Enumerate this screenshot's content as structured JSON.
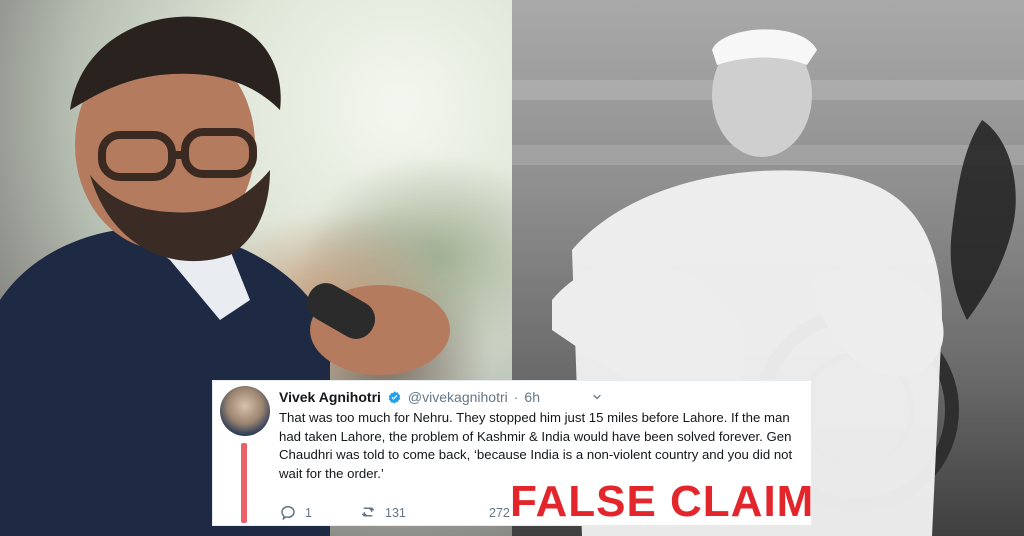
{
  "tweet": {
    "display_name": "Vivek Agnihotri",
    "handle": "@vivekagnihotri",
    "dot": "·",
    "time": "6h",
    "text": "That was too much for Nehru. They stopped him just 15 miles before Lahore. If the man had taken Lahore, the problem of Kashmir & India would have been solved forever. Gen Chaudhri was told to come back, ‘because India is a non-violent country and you did not wait for the order.’",
    "actions": {
      "replies": "1",
      "retweets": "131",
      "likes": "272"
    }
  },
  "overlay": {
    "label": "FALSE CLAIM",
    "color": "#e3262b"
  },
  "icons": {
    "verified": "verified-badge-icon",
    "caret": "chevron-down-icon",
    "reply": "reply-icon",
    "retweet": "retweet-icon"
  }
}
